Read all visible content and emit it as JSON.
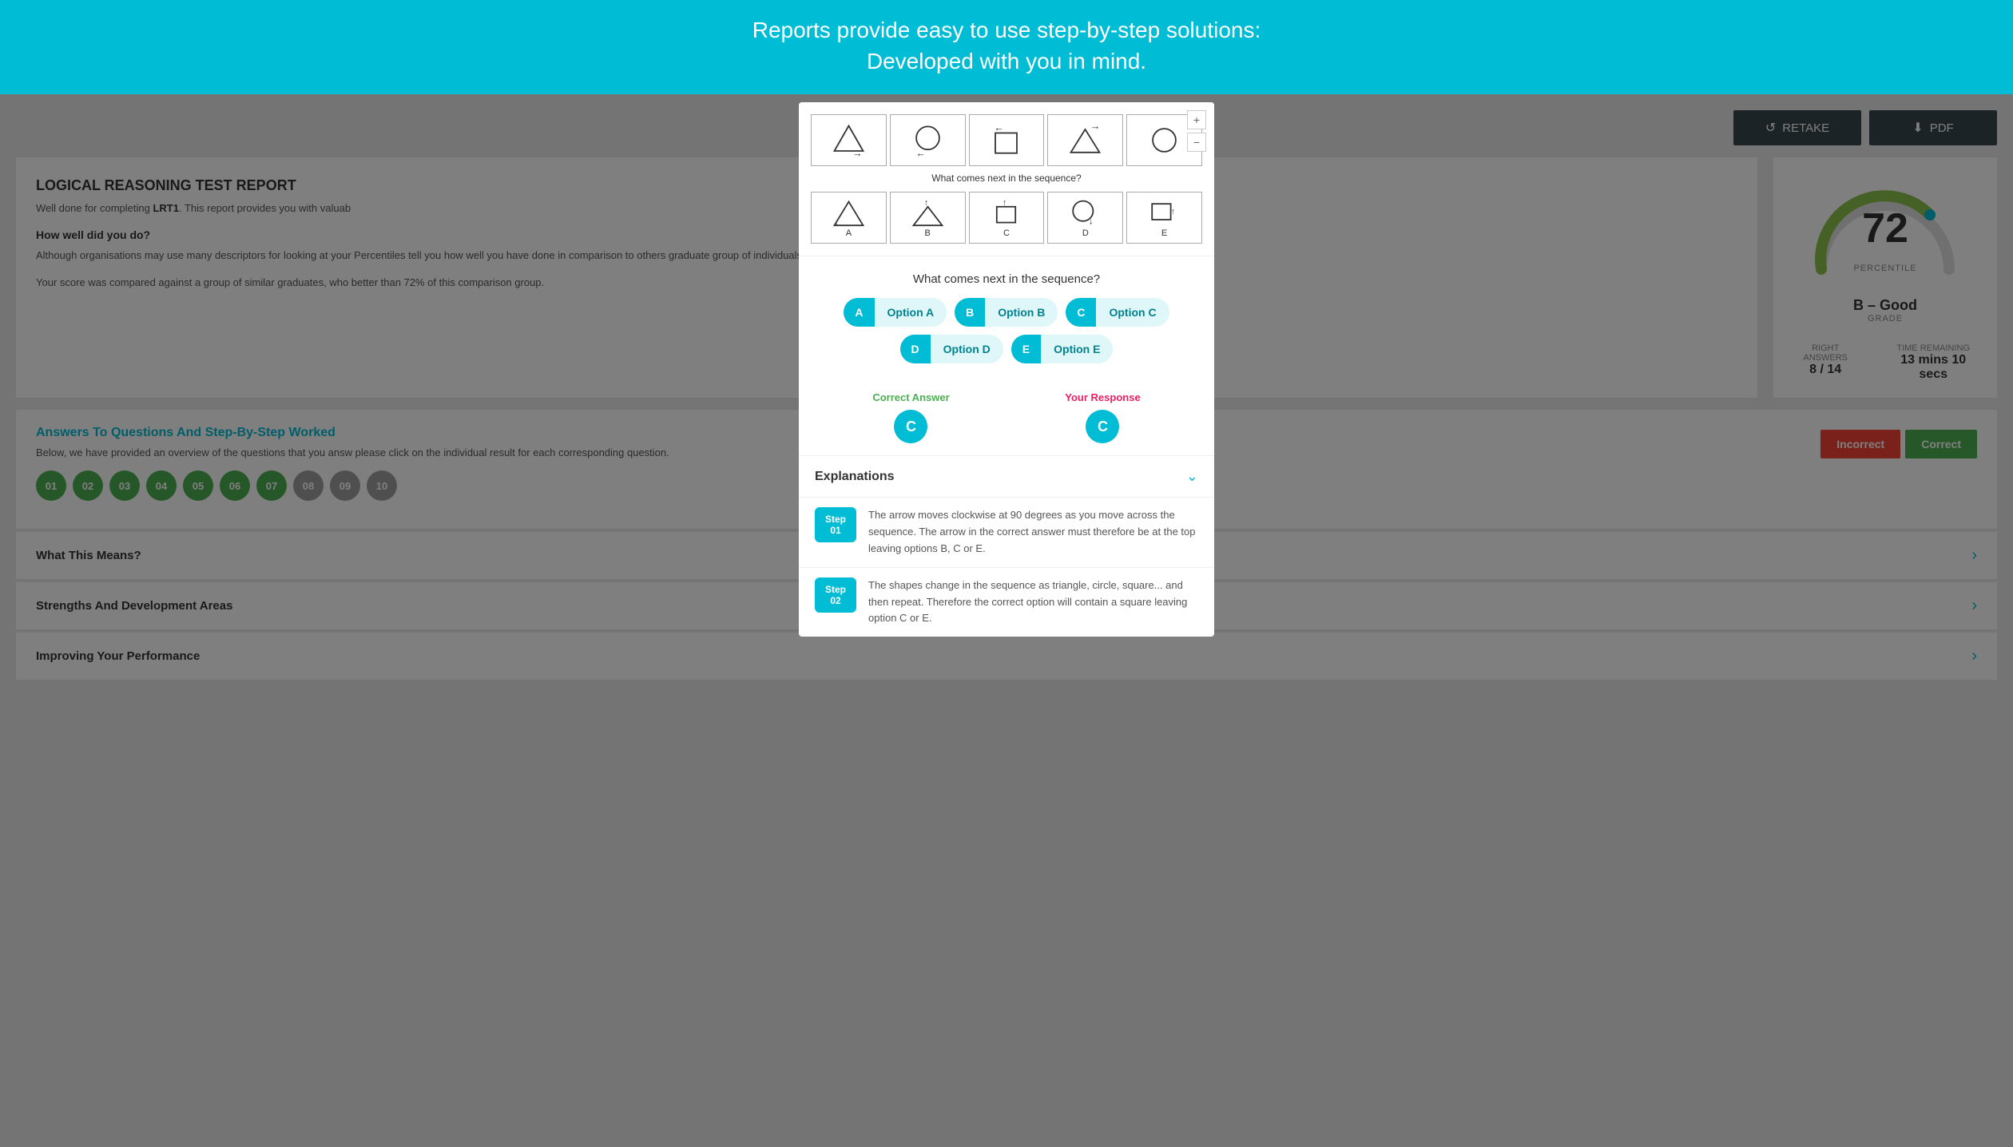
{
  "banner": {
    "text_line1": "Reports provide easy to use step-by-step solutions:",
    "text_line2": "Developed with you in mind."
  },
  "header": {
    "retake_label": "RETAKE",
    "pdf_label": "PDF"
  },
  "report": {
    "title": "LOGICAL REASONING TEST REPORT",
    "description_intro": "Well done for completing ",
    "test_code": "LRT1",
    "description_rest": ". This report provides you with valuab",
    "how_well_title": "How well did you do?",
    "how_well_text": "Although organisations may use many descriptors for looking at your Percentiles tell you how well you have done in comparison to others graduate group of individuals.",
    "score_text": "Your score was compared against a group of similar graduates, who better than 72% of this comparison group."
  },
  "gauge": {
    "value": 72,
    "label": "PERCENTILE",
    "grade": "B – Good",
    "grade_label": "GRADE"
  },
  "stats": {
    "right_answers_label": "RIGHT ANSWERS",
    "right_answers_value": "8 / 14",
    "time_remaining_label": "TIME REMAINING",
    "time_remaining_value": "13 mins 10 secs"
  },
  "answers_section": {
    "title": "Answers To Questions And Step-By-Step Worked",
    "description": "Below, we have provided an overview of the questions that you answ please click on the individual result for each corresponding question.",
    "bubbles": [
      "01",
      "02",
      "03",
      "04",
      "05",
      "06",
      "07",
      "08",
      "09",
      "10"
    ],
    "bubble_states": [
      "green",
      "green",
      "green",
      "green",
      "green",
      "green",
      "green",
      "grey",
      "grey",
      "grey"
    ]
  },
  "result_buttons": {
    "incorrect_label": "Incorrect",
    "correct_label": "Correct"
  },
  "sections": [
    {
      "title": "What This Means?"
    },
    {
      "title": "Strengths And Development Areas"
    },
    {
      "title": "Improving Your Performance"
    }
  ],
  "modal": {
    "question_text": "What comes next in the sequence?",
    "sequence_label": "What comes next in the sequence?",
    "options": [
      {
        "letter": "A",
        "label": "Option A"
      },
      {
        "letter": "B",
        "label": "Option B"
      },
      {
        "letter": "C",
        "label": "Option C"
      },
      {
        "letter": "D",
        "label": "Option D"
      },
      {
        "letter": "E",
        "label": "Option E"
      }
    ],
    "correct_answer_label": "Correct Answer",
    "correct_answer_value": "C",
    "your_response_label": "Your Response",
    "your_response_value": "C",
    "explanations_title": "Explanations",
    "steps": [
      {
        "badge_line1": "Step",
        "badge_line2": "01",
        "text": "The arrow moves clockwise at 90 degrees as you move across the sequence. The arrow in the correct answer must therefore be at the top leaving options B, C or E."
      },
      {
        "badge_line1": "Step",
        "badge_line2": "02",
        "text": "The shapes change in the sequence as triangle, circle, square... and then repeat.\nTherefore the correct option will contain a square leaving option C or E."
      }
    ]
  }
}
